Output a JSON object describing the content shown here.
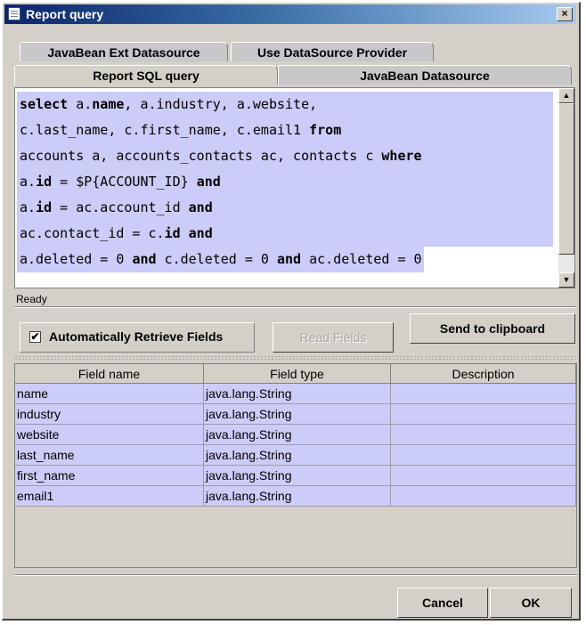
{
  "window": {
    "title": "Report query",
    "close_label": "×"
  },
  "tabs": {
    "row_back": [
      "JavaBean Ext Datasource",
      "Use DataSource Provider"
    ],
    "row_front": [
      "Report SQL query",
      "JavaBean Datasource"
    ],
    "active": "Report SQL query"
  },
  "query": {
    "lines": [
      [
        {
          "t": "select",
          "b": true
        },
        {
          "t": " a."
        },
        {
          "t": "name",
          "b": true
        },
        {
          "t": ", a.industry, a.website,"
        }
      ],
      [
        {
          "t": "c.last_name, c.first_name, c.email1 "
        },
        {
          "t": "from",
          "b": true
        }
      ],
      [
        {
          "t": "accounts a, accounts_contacts ac, contacts c "
        },
        {
          "t": "where",
          "b": true
        }
      ],
      [
        {
          "t": "a."
        },
        {
          "t": "id",
          "b": true
        },
        {
          "t": " = $P{ACCOUNT_ID} "
        },
        {
          "t": "and",
          "b": true
        }
      ],
      [
        {
          "t": "a."
        },
        {
          "t": "id",
          "b": true
        },
        {
          "t": " = ac.account_id "
        },
        {
          "t": "and",
          "b": true
        }
      ],
      [
        {
          "t": "ac.contact_id = c."
        },
        {
          "t": "id",
          "b": true
        },
        {
          "t": " "
        },
        {
          "t": "and",
          "b": true
        }
      ],
      [
        {
          "t": "a.deleted = 0 "
        },
        {
          "t": "and",
          "b": true
        },
        {
          "t": " c.deleted = 0 "
        },
        {
          "t": "and",
          "b": true
        },
        {
          "t": " ac.deleted = 0"
        }
      ]
    ]
  },
  "status_text": "Ready",
  "controls": {
    "auto_retrieve_label": "Automatically Retrieve Fields",
    "auto_retrieve_checked": true,
    "check_mark": "✔",
    "read_fields_label": "Read Fields",
    "send_clipboard_label": "Send to clipboard"
  },
  "fields_table": {
    "columns": [
      "Field name",
      "Field type",
      "Description"
    ],
    "rows": [
      [
        "name",
        "java.lang.String",
        ""
      ],
      [
        "industry",
        "java.lang.String",
        ""
      ],
      [
        "website",
        "java.lang.String",
        ""
      ],
      [
        "last_name",
        "java.lang.String",
        ""
      ],
      [
        "first_name",
        "java.lang.String",
        ""
      ],
      [
        "email1",
        "java.lang.String",
        ""
      ]
    ]
  },
  "footer": {
    "cancel_label": "Cancel",
    "ok_label": "OK"
  },
  "colors": {
    "selection": "#ccccf8",
    "titlebar_start": "#0a246a",
    "titlebar_end": "#a6caf0",
    "window_bg": "#d4d0c8"
  },
  "icons": {
    "title": "report-document-icon",
    "close": "close-icon",
    "scroll_up": "scroll-up-arrow-icon",
    "scroll_down": "scroll-down-arrow-icon",
    "check": "checkmark-icon"
  }
}
